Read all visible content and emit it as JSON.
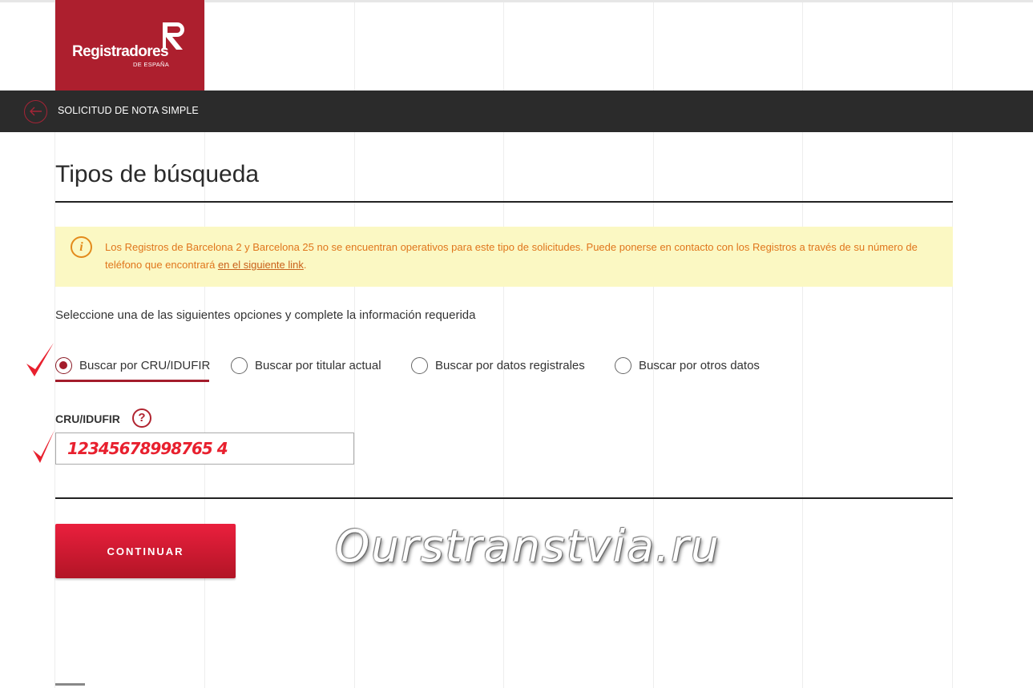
{
  "brand": {
    "name": "Registradores",
    "subtitle": "DE ESPAÑA",
    "color": "#ad1f2e"
  },
  "navbar": {
    "title": "SOLICITUD DE NOTA SIMPLE",
    "back_icon": "arrow-left-icon"
  },
  "page": {
    "title": "Tipos de búsqueda"
  },
  "alert": {
    "icon": "info-icon",
    "text_before_link": "Los Registros de Barcelona 2 y Barcelona 25 no se encuentran operativos para este tipo de solicitudes. Puede ponerse en contacto con los Registros a través de su número de teléfono que encontrará ",
    "link_text": "en el siguiente link",
    "text_after_link": ".",
    "bg_color": "#fbf8c3",
    "text_color": "#e0761c"
  },
  "instruction": "Seleccione una de las siguientes opciones y complete la información requerida",
  "search_options": [
    {
      "label": "Buscar por CRU/IDUFIR",
      "selected": true
    },
    {
      "label": "Buscar por titular actual",
      "selected": false
    },
    {
      "label": "Buscar por datos registrales",
      "selected": false
    },
    {
      "label": "Buscar por otros datos",
      "selected": false
    }
  ],
  "cru_field": {
    "label": "CRU/IDUFIR",
    "help_icon": "question-icon",
    "help_symbol": "?",
    "value": "12345678998765 4"
  },
  "continue_button": {
    "label": "CONTINUAR"
  },
  "annotations": {
    "check_icon": "check-icon",
    "check_color": "#e8202e"
  },
  "watermark": "Ourstranstvia.ru"
}
